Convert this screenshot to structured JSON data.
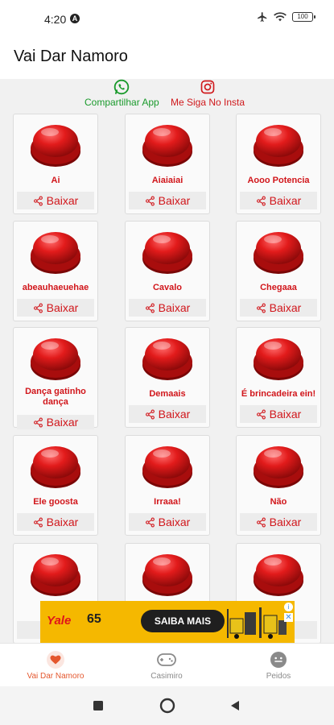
{
  "status_bar": {
    "time": "4:20",
    "notification": "A",
    "battery": "100"
  },
  "app_bar": {
    "title": "Vai Dar Namoro"
  },
  "share": {
    "whatsapp_label": "Compartilhar App",
    "instagram_label": "Me Siga No Insta",
    "whatsapp_icon": "whatsapp-icon",
    "instagram_icon": "instagram-icon"
  },
  "sounds": [
    {
      "label": "Ai",
      "download": "Baixar"
    },
    {
      "label": "Aiaiaiai",
      "download": "Baixar"
    },
    {
      "label": "Aooo Potencia",
      "download": "Baixar"
    },
    {
      "label": "abeauhaeuehae",
      "download": "Baixar"
    },
    {
      "label": "Cavalo",
      "download": "Baixar"
    },
    {
      "label": "Chegaaa",
      "download": "Baixar"
    },
    {
      "label": "Dança gatinho dança",
      "download": "Baixar"
    },
    {
      "label": "Demaais",
      "download": "Baixar"
    },
    {
      "label": "É brincadeira ein!",
      "download": "Baixar"
    },
    {
      "label": "Ele goosta",
      "download": "Baixar"
    },
    {
      "label": "Irraaa!",
      "download": "Baixar"
    },
    {
      "label": "Não",
      "download": "Baixar"
    },
    {
      "label": "",
      "download": ""
    },
    {
      "label": "",
      "download": ""
    },
    {
      "label": "",
      "download": ""
    }
  ],
  "ad": {
    "brand": "Yale",
    "badge": "65",
    "cta": "SAIBA MAIS",
    "info": "i",
    "close": "✕"
  },
  "bottom_nav": [
    {
      "label": "Vai Dar Namoro",
      "icon": "heart-icon",
      "active": true
    },
    {
      "label": "Casimiro",
      "icon": "gamepad-icon",
      "active": false
    },
    {
      "label": "Peidos",
      "icon": "smiley-icon",
      "active": false
    }
  ],
  "colors": {
    "accent": "#d1161b",
    "whatsapp": "#1a9a2c",
    "nav_active": "#e4572e",
    "ad_bg": "#f5b800"
  }
}
